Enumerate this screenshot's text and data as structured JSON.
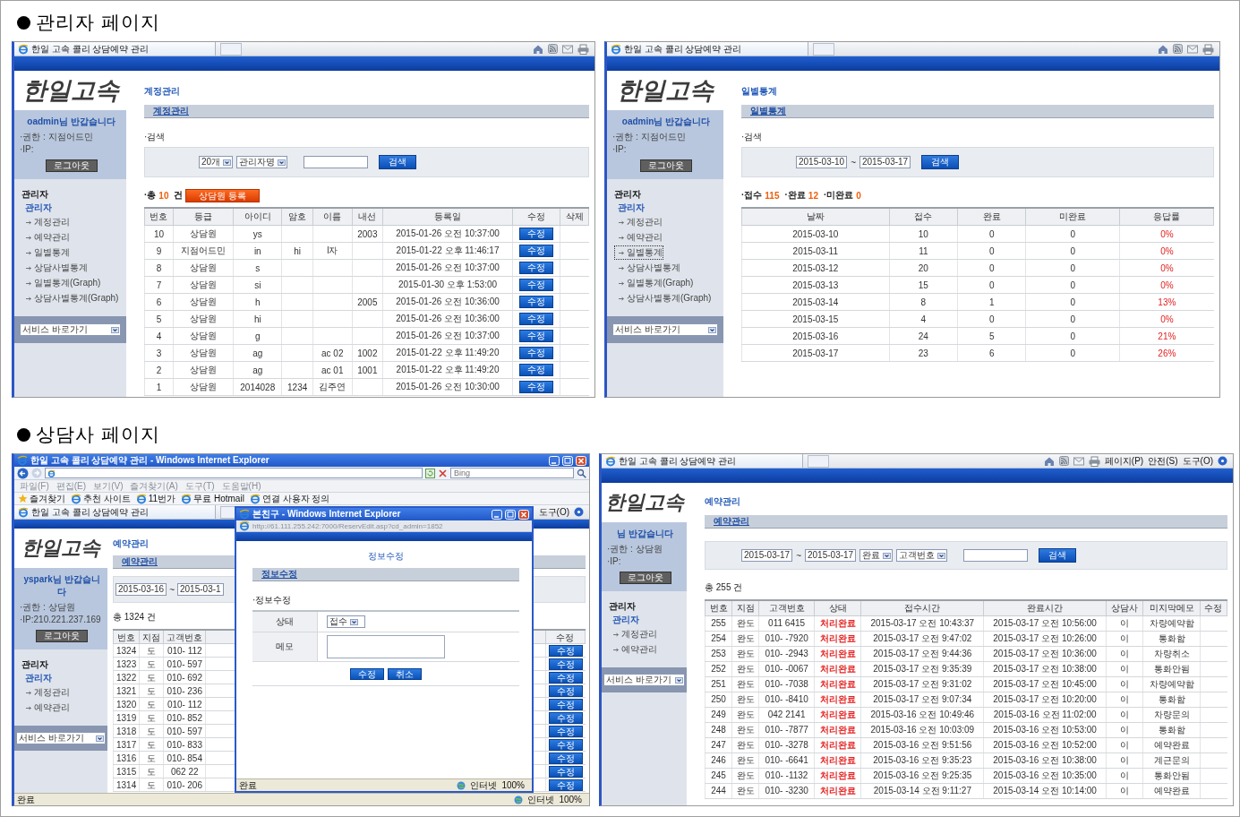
{
  "sections": [
    {
      "heading": "관리자 페이지",
      "panels": [
        {
          "browser": {
            "kind": "tabbed",
            "tab_title": "한일 고속 콜리 상담예약 관리"
          },
          "sidebar": {
            "logo": "한일고속",
            "greeting": "oadmin님 반갑습니다",
            "info": [
              "·권한 : 지점어드민",
              "·IP:"
            ],
            "logout": "로그아웃",
            "menu_heading": "관리자",
            "menu_group": "관리자",
            "menu_items": [
              {
                "label": "계정관리",
                "selected": false
              },
              {
                "label": "예약관리",
                "selected": false
              },
              {
                "label": "일별통계",
                "selected": false
              },
              {
                "label": "상담사별통계",
                "selected": false
              },
              {
                "label": "일별통계(Graph)",
                "selected": false
              },
              {
                "label": "상담사별통계(Graph)",
                "selected": false
              }
            ],
            "quick_select": "서비스 바로가기"
          },
          "content": {
            "title": "계정관리",
            "subtab": "계정관리",
            "search_label": "·검색",
            "search": [
              {
                "kind": "select",
                "value": "20개"
              },
              {
                "kind": "select",
                "value": "관리자명"
              },
              {
                "kind": "input"
              },
              {
                "kind": "button",
                "label": "검색"
              }
            ],
            "summary": {
              "parts": [
                {
                  "kind": "label",
                  "text": "·총"
                },
                {
                  "kind": "value",
                  "text": "10"
                },
                {
                  "kind": "label",
                  "text": "건"
                }
              ],
              "button": "상담원 등록"
            },
            "table": {
              "columns": [
                {
                  "label": "번호"
                },
                {
                  "label": "등급"
                },
                {
                  "label": "아이디"
                },
                {
                  "label": "암호"
                },
                {
                  "label": "이름"
                },
                {
                  "label": "내선"
                },
                {
                  "label": "등록일"
                },
                {
                  "label": "수정",
                  "kind": "button"
                },
                {
                  "label": "삭제"
                }
              ],
              "rows": [
                [
                  "10",
                  "상담원",
                  "ys",
                  null,
                  null,
                  "2003",
                  "2015-01-26 오전 10:37:00",
                  "수정",
                  null
                ],
                [
                  "9",
                  "지점어드민",
                  "in",
                  "hi",
                  "l자",
                  null,
                  "2015-01-22 오후 11:46:17",
                  "수정",
                  null
                ],
                [
                  "8",
                  "상담원",
                  "s",
                  null,
                  null,
                  null,
                  "2015-01-26 오전 10:37:00",
                  "수정",
                  null
                ],
                [
                  "7",
                  "상담원",
                  "si",
                  null,
                  null,
                  null,
                  "2015-01-30 오후 1:53:00",
                  "수정",
                  null
                ],
                [
                  "6",
                  "상담원",
                  "h",
                  null,
                  null,
                  "2005",
                  "2015-01-26 오전 10:36:00",
                  "수정",
                  null
                ],
                [
                  "5",
                  "상담원",
                  "hi",
                  null,
                  null,
                  null,
                  "2015-01-26 오전 10:36:00",
                  "수정",
                  null
                ],
                [
                  "4",
                  "상담원",
                  "g",
                  null,
                  null,
                  null,
                  "2015-01-26 오전 10:37:00",
                  "수정",
                  null
                ],
                [
                  "3",
                  "상담원",
                  "ag",
                  null,
                  "ac 02",
                  "1002",
                  "2015-01-22 오후 11:49:20",
                  "수정",
                  null
                ],
                [
                  "2",
                  "상담원",
                  "ag",
                  null,
                  "ac 01",
                  "1001",
                  "2015-01-22 오후 11:49:20",
                  "수정",
                  null
                ],
                [
                  "1",
                  "상담원",
                  "2014028",
                  "1234",
                  "김주연",
                  null,
                  "2015-01-26 오전 10:30:00",
                  "수정",
                  null
                ]
              ]
            }
          }
        },
        {
          "browser": {
            "kind": "tabbed",
            "tab_title": "한일 고속 콜리 상담예약 관리"
          },
          "sidebar": {
            "logo": "한일고속",
            "greeting": "oadmin님 반갑습니다",
            "info": [
              "·권한 : 지점어드민",
              "·IP:"
            ],
            "logout": "로그아웃",
            "menu_heading": "관리자",
            "menu_group": "관리자",
            "menu_items": [
              {
                "label": "계정관리",
                "selected": false
              },
              {
                "label": "예약관리",
                "selected": false
              },
              {
                "label": "일별통계",
                "selected": true
              },
              {
                "label": "상담사별통계",
                "selected": false
              },
              {
                "label": "일별통계(Graph)",
                "selected": false
              },
              {
                "label": "상담사별통계(Graph)",
                "selected": false
              }
            ],
            "quick_select": "서비스 바로가기"
          },
          "content": {
            "title": "일별통계",
            "subtab": "일별통계",
            "search_label": "·검색",
            "search": [
              {
                "kind": "date",
                "value": "2015-03-10"
              },
              {
                "kind": "sep",
                "text": "~"
              },
              {
                "kind": "date",
                "value": "2015-03-17"
              },
              {
                "kind": "button",
                "label": "검색"
              }
            ],
            "summary": {
              "parts": [
                {
                  "kind": "label",
                  "text": "·접수"
                },
                {
                  "kind": "value",
                  "text": "115"
                },
                {
                  "kind": "label",
                  "text": "·완료"
                },
                {
                  "kind": "value",
                  "text": "12"
                },
                {
                  "kind": "label",
                  "text": "·미완료"
                },
                {
                  "kind": "value",
                  "text": "0"
                }
              ]
            },
            "table": {
              "columns": [
                {
                  "label": "날짜"
                },
                {
                  "label": "접수"
                },
                {
                  "label": "완료"
                },
                {
                  "label": "미완료"
                },
                {
                  "label": "응답률",
                  "kind": "rate"
                }
              ],
              "rows": [
                [
                  "2015-03-10",
                  "10",
                  "0",
                  "0",
                  "0%"
                ],
                [
                  "2015-03-11",
                  "11",
                  "0",
                  "0",
                  "0%"
                ],
                [
                  "2015-03-12",
                  "20",
                  "0",
                  "0",
                  "0%"
                ],
                [
                  "2015-03-13",
                  "15",
                  "0",
                  "0",
                  "0%"
                ],
                [
                  "2015-03-14",
                  "8",
                  "1",
                  "0",
                  "13%"
                ],
                [
                  "2015-03-15",
                  "4",
                  "0",
                  "0",
                  "0%"
                ],
                [
                  "2015-03-16",
                  "24",
                  "5",
                  "0",
                  "21%"
                ],
                [
                  "2015-03-17",
                  "23",
                  "6",
                  "0",
                  "26%"
                ]
              ]
            }
          }
        }
      ]
    },
    {
      "heading": "상담사 페이지",
      "panels": [
        {
          "browser": {
            "kind": "window",
            "title": "한일 고속 콜리 상담예약 관리 - Windows Internet Explorer",
            "search_placeholder": "Bing",
            "menus": [
              "파일(F)",
              "편집(E)",
              "보기(V)",
              "즐겨찾기(A)",
              "도구(T)",
              "도움말(H)"
            ],
            "favorites_label": "즐겨찾기",
            "favorites": [
              "추천 사이트",
              "11번가",
              "무료 Hotmail",
              "연결 사용자 정의"
            ],
            "tab_title": "한일 고속 콜리 상담예약 관리",
            "tools": [
              "도구(O)"
            ],
            "status": {
              "text": "완료",
              "zone": "인터넷",
              "zoom": "100%"
            }
          },
          "sidebar": {
            "logo": "한일고속",
            "greeting": "yspark님 반갑습니다",
            "info": [
              "·권한 : 상담원",
              "·IP:210.221.237.169"
            ],
            "logout": "로그아웃",
            "menu_heading": "관리자",
            "menu_group": "관리자",
            "menu_items": [
              {
                "label": "계정관리",
                "selected": false
              },
              {
                "label": "예약관리",
                "selected": false
              }
            ],
            "quick_select": "서비스 바로가기"
          },
          "content": {
            "title": "예약관리",
            "subtab": "예약관리",
            "search": [
              {
                "kind": "date",
                "value": "2015-03-16"
              },
              {
                "kind": "sep",
                "text": "~"
              },
              {
                "kind": "date",
                "value": "2015-03-1"
              }
            ],
            "summary": {
              "parts": [
                {
                  "kind": "label",
                  "text": "총 1324 건"
                }
              ]
            },
            "table": {
              "columns": [
                {
                  "label": "번호"
                },
                {
                  "label": "지점"
                },
                {
                  "label": "고객번호"
                },
                {
                  "kind": "covered"
                },
                {
                  "label": "수정",
                  "kind": "button"
                }
              ],
              "rows": [
                [
                  "1324",
                  "도",
                  "010- 112",
                  null,
                  "수정"
                ],
                [
                  "1323",
                  "도",
                  "010- 597",
                  null,
                  "수정"
                ],
                [
                  "1322",
                  "도",
                  "010- 692",
                  null,
                  "수정"
                ],
                [
                  "1321",
                  "도",
                  "010- 236",
                  null,
                  "수정"
                ],
                [
                  "1320",
                  "도",
                  "010- 112",
                  null,
                  "수정"
                ],
                [
                  "1319",
                  "도",
                  "010- 852",
                  null,
                  "수정"
                ],
                [
                  "1318",
                  "도",
                  "010- 597",
                  null,
                  "수정"
                ],
                [
                  "1317",
                  "도",
                  "010- 833",
                  null,
                  "수정"
                ],
                [
                  "1316",
                  "도",
                  "010- 854",
                  null,
                  "수정"
                ],
                [
                  "1315",
                  "도",
                  "062 22",
                  null,
                  "수정"
                ],
                [
                  "1314",
                  "도",
                  "010- 206",
                  null,
                  "수정"
                ]
              ]
            }
          },
          "popup": {
            "title": "본친구 - Windows Internet Explorer",
            "address": "http://61.111.255.242:7000/ReservEdit.asp?cd_admin=1852",
            "heading": "정보수정",
            "subtab": "정보수정",
            "section_label": "·정보수정",
            "form": [
              {
                "label": "상태",
                "kind": "select",
                "value": "접수"
              },
              {
                "label": "메모",
                "kind": "textarea"
              }
            ],
            "buttons": [
              "수정",
              "취소"
            ],
            "status": {
              "text": "완료",
              "zone": "인터넷",
              "zoom": "100%"
            }
          }
        },
        {
          "browser": {
            "kind": "tabbed",
            "tab_title": "한일 고속 콜리 상담예약 관리",
            "menus": [
              "페이지(P)",
              "안전(S)",
              "도구(O)"
            ]
          },
          "sidebar": {
            "logo": "한일고속",
            "greeting": "님 반갑습니다",
            "info": [
              "·권한 : 상담원",
              "·IP:"
            ],
            "logout": "로그아웃",
            "menu_heading": "관리자",
            "menu_group": "관리자",
            "menu_items": [
              {
                "label": "계정관리",
                "selected": false
              },
              {
                "label": "예약관리",
                "selected": false
              }
            ],
            "quick_select": "서비스 바로가기"
          },
          "content": {
            "title": "예약관리",
            "subtab": "예약관리",
            "search": [
              {
                "kind": "date",
                "value": "2015-03-17"
              },
              {
                "kind": "sep",
                "text": "~"
              },
              {
                "kind": "date",
                "value": "2015-03-17"
              },
              {
                "kind": "select",
                "value": "완료"
              },
              {
                "kind": "select",
                "value": "고객번호"
              },
              {
                "kind": "input"
              },
              {
                "kind": "button",
                "label": "검색"
              }
            ],
            "summary": {
              "parts": [
                {
                  "kind": "label",
                  "text": "총 255 건"
                }
              ]
            },
            "table": {
              "columns": [
                {
                  "label": "번호"
                },
                {
                  "label": "지점"
                },
                {
                  "label": "고객번호"
                },
                {
                  "label": "상태",
                  "kind": "status"
                },
                {
                  "label": "접수시간"
                },
                {
                  "label": "완료시간"
                },
                {
                  "label": "상담사"
                },
                {
                  "label": "미지막메모"
                },
                {
                  "label": "수정"
                }
              ],
              "rows": [
                [
                  "255",
                  "완도",
                  "011 6415",
                  "처리완료",
                  "2015-03-17 오전 10:43:37",
                  "2015-03-17 오전 10:56:00",
                  "이",
                  "차량예약함",
                  null
                ],
                [
                  "254",
                  "완도",
                  "010- -7920",
                  "처리완료",
                  "2015-03-17 오전 9:47:02",
                  "2015-03-17 오전 10:26:00",
                  "이",
                  "통화함",
                  null
                ],
                [
                  "253",
                  "완도",
                  "010- -2943",
                  "처리완료",
                  "2015-03-17 오전 9:44:36",
                  "2015-03-17 오전 10:36:00",
                  "이",
                  "차량취소",
                  null
                ],
                [
                  "252",
                  "완도",
                  "010- -0067",
                  "처리완료",
                  "2015-03-17 오전 9:35:39",
                  "2015-03-17 오전 10:38:00",
                  "이",
                  "통화안됨",
                  null
                ],
                [
                  "251",
                  "완도",
                  "010- -7038",
                  "처리완료",
                  "2015-03-17 오전 9:31:02",
                  "2015-03-17 오전 10:45:00",
                  "이",
                  "차량예약함",
                  null
                ],
                [
                  "250",
                  "완도",
                  "010- -8410",
                  "처리완료",
                  "2015-03-17 오전 9:07:34",
                  "2015-03-17 오전 10:20:00",
                  "이",
                  "통화함",
                  null
                ],
                [
                  "249",
                  "완도",
                  "042 2141",
                  "처리완료",
                  "2015-03-16 오전 10:49:46",
                  "2015-03-16 오전 11:02:00",
                  "이",
                  "차량문의",
                  null
                ],
                [
                  "248",
                  "완도",
                  "010- -7877",
                  "처리완료",
                  "2015-03-16 오전 10:03:09",
                  "2015-03-16 오전 10:53:00",
                  "이",
                  "통화함",
                  null
                ],
                [
                  "247",
                  "완도",
                  "010- -3278",
                  "처리완료",
                  "2015-03-16 오전 9:51:56",
                  "2015-03-16 오전 10:52:00",
                  "이",
                  "예약완료",
                  null
                ],
                [
                  "246",
                  "완도",
                  "010- -6641",
                  "처리완료",
                  "2015-03-16 오전 9:35:23",
                  "2015-03-16 오전 10:38:00",
                  "이",
                  "계근문의",
                  null
                ],
                [
                  "245",
                  "완도",
                  "010- -1132",
                  "처리완료",
                  "2015-03-16 오전 9:25:35",
                  "2015-03-16 오전 10:35:00",
                  "이",
                  "통화안됨",
                  null
                ],
                [
                  "244",
                  "완도",
                  "010- -3230",
                  "처리완료",
                  "2015-03-14 오전 9:11:27",
                  "2015-03-14 오전 10:14:00",
                  "이",
                  "예약완료",
                  null
                ]
              ]
            }
          }
        }
      ]
    }
  ]
}
